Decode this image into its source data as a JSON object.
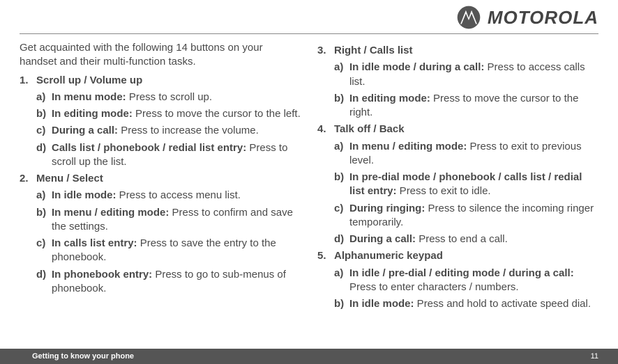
{
  "brand": "MOTOROLA",
  "intro": "Get acquainted with the following 14 buttons on your handset and their multi-function tasks.",
  "left": {
    "sections": [
      {
        "num": "1.",
        "title": "Scroll up / Volume up",
        "items": [
          {
            "letter": "a)",
            "lead": "In menu mode:",
            "text": " Press to scroll up."
          },
          {
            "letter": "b)",
            "lead": "In editing mode:",
            "text": " Press to move the cursor to the left."
          },
          {
            "letter": "c)",
            "lead": "During a call:",
            "text": " Press to increase the volume."
          },
          {
            "letter": "d)",
            "lead": "Calls list / phonebook / redial list entry:",
            "text": " Press to scroll up the list."
          }
        ]
      },
      {
        "num": "2.",
        "title": "Menu / Select",
        "items": [
          {
            "letter": "a)",
            "lead": "In idle mode:",
            "text": " Press to access menu list."
          },
          {
            "letter": "b)",
            "lead": "In menu / editing mode:",
            "text": " Press to confirm and save the settings."
          },
          {
            "letter": "c)",
            "lead": "In calls list entry:",
            "text": " Press to save the entry to the phonebook."
          },
          {
            "letter": "d)",
            "lead": "In phonebook entry:",
            "text": " Press to go to sub-menus of phonebook."
          }
        ]
      }
    ]
  },
  "right": {
    "sections": [
      {
        "num": "3.",
        "title": "Right / Calls list",
        "items": [
          {
            "letter": "a)",
            "lead": "In idle mode / during a call:",
            "text": " Press to access calls list."
          },
          {
            "letter": "b)",
            "lead": "In editing mode:",
            "text": " Press to move the cursor to the right."
          }
        ]
      },
      {
        "num": "4.",
        "title": "Talk off / Back",
        "items": [
          {
            "letter": "a)",
            "lead": "In menu / editing mode:",
            "text": " Press to exit to previous level."
          },
          {
            "letter": "b)",
            "lead": "In pre-dial mode / phonebook / calls list / redial list entry:",
            "text": " Press to exit to idle."
          },
          {
            "letter": "c)",
            "lead": "During ringing:",
            "text": " Press to silence the incoming ringer temporarily."
          },
          {
            "letter": "d)",
            "lead": "During a call:",
            "text": " Press to end a call."
          }
        ]
      },
      {
        "num": "5.",
        "title": "Alphanumeric keypad",
        "items": [
          {
            "letter": "a)",
            "lead": "In idle / pre-dial / editing mode / during a call:",
            "text": " Press to enter characters / numbers."
          },
          {
            "letter": "b)",
            "lead": "In idle mode:",
            "text": " Press and hold to activate speed dial."
          }
        ]
      }
    ]
  },
  "footer": {
    "title": "Getting to know your phone",
    "page": "11"
  }
}
